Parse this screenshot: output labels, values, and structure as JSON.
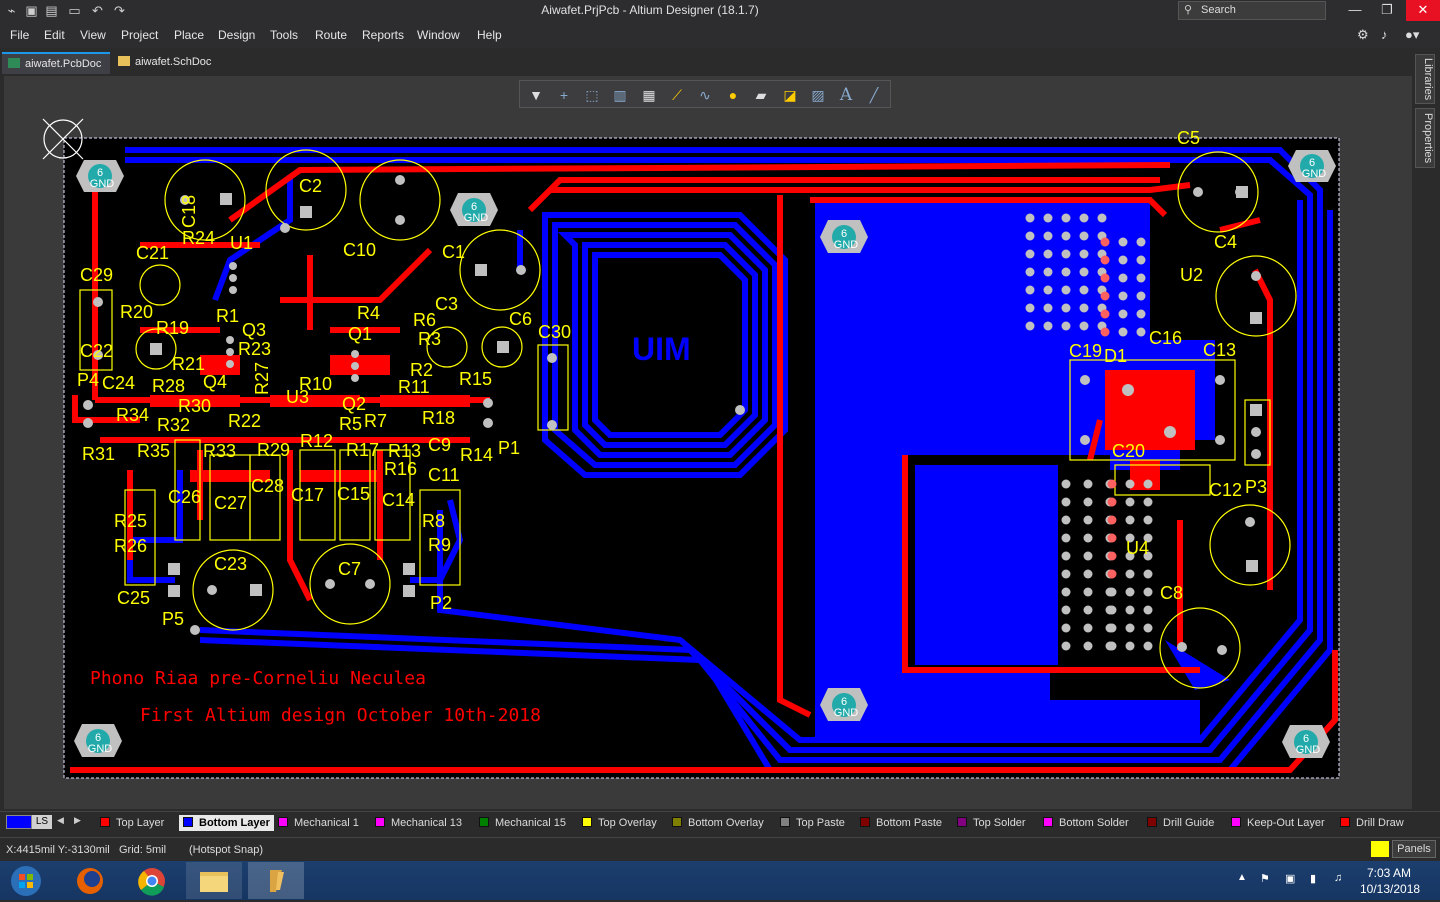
{
  "window": {
    "title": "Aiwafet.PrjPcb - Altium Designer (18.1.7)",
    "search_placeholder": "Search",
    "minimize": "—",
    "maximize": "❐",
    "close": "✕"
  },
  "menu": [
    "File",
    "Edit",
    "View",
    "Project",
    "Place",
    "Design",
    "Tools",
    "Route",
    "Reports",
    "Window",
    "Help"
  ],
  "tabs": [
    {
      "label": "aiwafet.PcbDoc",
      "active": true
    },
    {
      "label": "aiwafet.SchDoc",
      "active": false
    }
  ],
  "side_panels": [
    "Libraries",
    "Properties"
  ],
  "toolbar_icons": [
    "filter-icon",
    "crosshair-icon",
    "select-rect-icon",
    "chart-icon",
    "component-icon",
    "route-icon",
    "interactive-route-icon",
    "pad-icon",
    "polygon-icon",
    "region-icon",
    "fill-icon",
    "text-icon",
    "line-icon"
  ],
  "board": {
    "silkscreen_line1": "Phono Riaa pre-Corneliu Neculea",
    "silkscreen_line2": "First  Altium  design  October  10th-2018",
    "bottom_text": "UIM",
    "mount_hole_label_num": "6",
    "mount_hole_label_net": "GND",
    "designators": [
      {
        "t": "C18"
      },
      {
        "t": "C2"
      },
      {
        "t": "C10"
      },
      {
        "t": "C1"
      },
      {
        "t": "C5"
      },
      {
        "t": "C4"
      },
      {
        "t": "U2"
      },
      {
        "t": "U1"
      },
      {
        "t": "R24"
      },
      {
        "t": "C21"
      },
      {
        "t": "C29"
      },
      {
        "t": "R20"
      },
      {
        "t": "R19"
      },
      {
        "t": "C22"
      },
      {
        "t": "R23"
      },
      {
        "t": "R21"
      },
      {
        "t": "P4"
      },
      {
        "t": "C24"
      },
      {
        "t": "R28"
      },
      {
        "t": "Q4"
      },
      {
        "t": "R34"
      },
      {
        "t": "R30"
      },
      {
        "t": "R22"
      },
      {
        "t": "R32"
      },
      {
        "t": "R31"
      },
      {
        "t": "R35"
      },
      {
        "t": "R33"
      },
      {
        "t": "R29"
      },
      {
        "t": "R12"
      },
      {
        "t": "R17"
      },
      {
        "t": "R13"
      },
      {
        "t": "R16"
      },
      {
        "t": "R4"
      },
      {
        "t": "Q1"
      },
      {
        "t": "C3"
      },
      {
        "t": "R6"
      },
      {
        "t": "R3"
      },
      {
        "t": "C6"
      },
      {
        "t": "R2"
      },
      {
        "t": "R11"
      },
      {
        "t": "R15"
      },
      {
        "t": "R10"
      },
      {
        "t": "R5"
      },
      {
        "t": "R7"
      },
      {
        "t": "R18"
      },
      {
        "t": "C9"
      },
      {
        "t": "R14"
      },
      {
        "t": "C11"
      },
      {
        "t": "P1"
      },
      {
        "t": "C30"
      },
      {
        "t": "C26"
      },
      {
        "t": "C27"
      },
      {
        "t": "C28"
      },
      {
        "t": "C17"
      },
      {
        "t": "C15"
      },
      {
        "t": "C14"
      },
      {
        "t": "R8"
      },
      {
        "t": "R9"
      },
      {
        "t": "R25"
      },
      {
        "t": "R26"
      },
      {
        "t": "C25"
      },
      {
        "t": "C23"
      },
      {
        "t": "C7"
      },
      {
        "t": "P5"
      },
      {
        "t": "P2"
      },
      {
        "t": "C19"
      },
      {
        "t": "D1"
      },
      {
        "t": "C16"
      },
      {
        "t": "C13"
      },
      {
        "t": "C20"
      },
      {
        "t": "C12"
      },
      {
        "t": "P3"
      },
      {
        "t": "U4"
      },
      {
        "t": "C8"
      },
      {
        "t": "Q3"
      },
      {
        "t": "R1"
      },
      {
        "t": "R27"
      },
      {
        "t": "U3"
      },
      {
        "t": "Q2"
      }
    ]
  },
  "layers": {
    "current_indicator": "LS",
    "tabs": [
      {
        "label": "Top Layer",
        "color": "#ff0000"
      },
      {
        "label": "Bottom Layer",
        "color": "#0000ff",
        "active": true
      },
      {
        "label": "Mechanical 1",
        "color": "#ff00ff"
      },
      {
        "label": "Mechanical 13",
        "color": "#ff00ff"
      },
      {
        "label": "Mechanical 15",
        "color": "#008000"
      },
      {
        "label": "Top Overlay",
        "color": "#ffff00"
      },
      {
        "label": "Bottom Overlay",
        "color": "#808000"
      },
      {
        "label": "Top Paste",
        "color": "#808080"
      },
      {
        "label": "Bottom Paste",
        "color": "#800000"
      },
      {
        "label": "Top Solder",
        "color": "#800080"
      },
      {
        "label": "Bottom Solder",
        "color": "#ff00ff"
      },
      {
        "label": "Drill Guide",
        "color": "#800000"
      },
      {
        "label": "Keep-Out Layer",
        "color": "#ff00ff"
      },
      {
        "label": "Drill Draw",
        "color": "#ff0000"
      }
    ]
  },
  "status": {
    "coords": "X:4415mil Y:-3130mil",
    "grid": "Grid: 5mil",
    "snap": "(Hotspot Snap)",
    "panels_button": "Panels"
  },
  "taskbar": {
    "apps": [
      "start-button",
      "firefox",
      "chrome",
      "file-explorer",
      "altium-designer"
    ],
    "time": "7:03 AM",
    "date": "10/13/2018"
  },
  "colors": {
    "top_layer": "#ff0000",
    "bottom_layer": "#0000ff",
    "overlay": "#ffff00",
    "board_bg": "#000000",
    "via": "#c0c0c0"
  }
}
